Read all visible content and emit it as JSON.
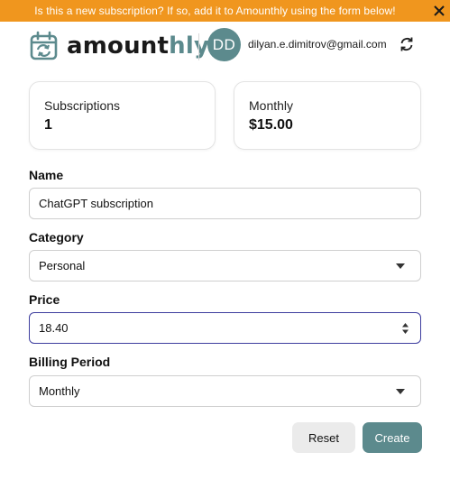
{
  "banner": {
    "message": "Is this a new subscription? If so, add it to Amounthly using the form below!",
    "background": "#f0961e"
  },
  "header": {
    "logo_part1": "amount",
    "logo_part2": "hly",
    "avatar_initials": "DD",
    "email": "dilyan.e.dimitrov@gmail.com",
    "brand_color": "#5c8a8d"
  },
  "stats": {
    "subscriptions_label": "Subscriptions",
    "subscriptions_value": "1",
    "monthly_label": "Monthly",
    "monthly_value": "$15.00"
  },
  "form": {
    "name_label": "Name",
    "name_value": "ChatGPT subscription",
    "category_label": "Category",
    "category_value": "Personal",
    "price_label": "Price",
    "price_value": "18.40",
    "billing_label": "Billing Period",
    "billing_value": "Monthly"
  },
  "buttons": {
    "reset": "Reset",
    "create": "Create"
  }
}
